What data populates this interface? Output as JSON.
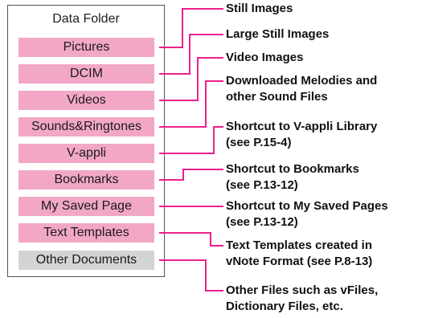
{
  "panel_title": "Data Folder",
  "accent_color": "#ee1f8a",
  "folders": [
    {
      "label": "Pictures",
      "style": "pink"
    },
    {
      "label": "DCIM",
      "style": "pink"
    },
    {
      "label": "Videos",
      "style": "pink"
    },
    {
      "label": "Sounds&Ringtones",
      "style": "pink"
    },
    {
      "label": "V-appli",
      "style": "pink"
    },
    {
      "label": "Bookmarks",
      "style": "pink"
    },
    {
      "label": "My Saved Page",
      "style": "pink"
    },
    {
      "label": "Text Templates",
      "style": "pink"
    },
    {
      "label": "Other Documents",
      "style": "gray"
    }
  ],
  "descriptions": [
    {
      "lines": [
        "Still Images"
      ]
    },
    {
      "lines": [
        "Large Still Images"
      ]
    },
    {
      "lines": [
        "Video Images"
      ]
    },
    {
      "lines": [
        "Downloaded Melodies and",
        "other Sound Files"
      ]
    },
    {
      "lines": [
        "Shortcut to V-appli Library",
        "(see P.15-4)"
      ]
    },
    {
      "lines": [
        "Shortcut to Bookmarks",
        "(see P.13-12)"
      ]
    },
    {
      "lines": [
        "Shortcut to My Saved Pages",
        "(see P.13-12)"
      ]
    },
    {
      "lines": [
        "Text Templates created in",
        "vNote Format (see P.8-13)"
      ]
    },
    {
      "lines": [
        "Other Files such as vFiles,",
        "Dictionary Files, etc."
      ]
    }
  ]
}
